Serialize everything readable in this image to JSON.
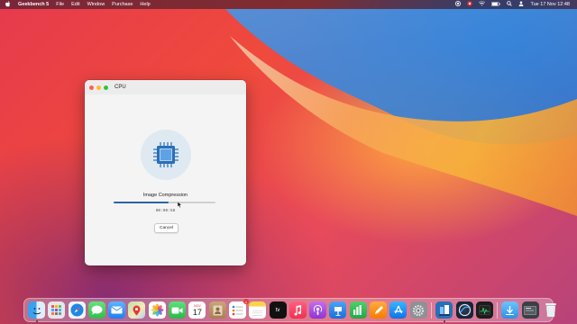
{
  "menubar": {
    "app_name": "Geekbench 5",
    "items": [
      "File",
      "Edit",
      "Window",
      "Purchase",
      "Help"
    ],
    "clock": "Tue 17 Nov  12:48"
  },
  "window": {
    "title": "CPU",
    "test_name": "Image Compression",
    "progress": 0.54,
    "elapsed": "00:00:58",
    "cancel_label": "Cancel"
  },
  "dock": {
    "calendar_month": "NOV",
    "calendar_day": "17",
    "reminders_badge": "1",
    "tv_label": "tv"
  },
  "colors": {
    "progress_fill": "#2a64a8",
    "window_bg": "#f4f4f4",
    "chip_icon": "#2a6fb8"
  }
}
